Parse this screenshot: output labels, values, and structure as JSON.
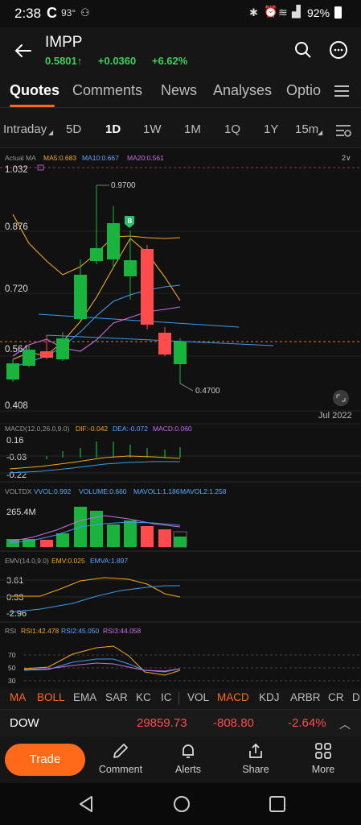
{
  "status": {
    "time": "2:38",
    "temp": "93°",
    "battery": "92%"
  },
  "header": {
    "ticker": "IMPP",
    "price": "0.5801",
    "change": "+0.0360",
    "change_pct": "+6.62%",
    "price_arrow": "↑"
  },
  "tabs": [
    "Quotes",
    "Comments",
    "News",
    "Analyses",
    "Optio"
  ],
  "periods": [
    "Intraday",
    "5D",
    "1D",
    "1W",
    "1M",
    "1Q",
    "1Y",
    "15m"
  ],
  "active_period": "1D",
  "main_chart": {
    "legend": {
      "label": "Actual MA",
      "ma5": "MA5:0.683",
      "ma10": "MA10:0.667",
      "ma20": "MA20:0.561"
    },
    "y_ticks": [
      "1.032",
      "0.876",
      "0.720",
      "0.564",
      "0.408"
    ],
    "high_label": "0.9700",
    "low_label": "0.4700",
    "date_label": "Jul 2022",
    "badge": "B",
    "layout_toggle": "2∨"
  },
  "macd": {
    "legend": {
      "label": "MACD(12.0,26.0,9.0)",
      "dif": "DIF:-0.042",
      "dea": "DEA:-0.072",
      "macd": "MACD:0.060"
    },
    "y_ticks": [
      "0.16",
      "-0.03",
      "-0.22"
    ]
  },
  "volume": {
    "legend": {
      "label": "VOLTDX",
      "vvol": "VVOL:0.992",
      "volume": "VOLUME:0.660",
      "mavol1": "MAVOL1:1.186",
      "mavol2": "MAVOL2:1.258"
    },
    "y_tick": "265.4M"
  },
  "emv": {
    "legend": {
      "label": "EMV(14.0,9.0)",
      "emv": "EMV:0.025",
      "emva": "EMVA:1.897"
    },
    "y_ticks": [
      "3.61",
      "0.33",
      "-2.96"
    ]
  },
  "rsi": {
    "legend": {
      "label": "RSI",
      "rsi1": "RSI1:42.478",
      "rsi2": "RSI2:45.050",
      "rsi3": "RSI3:44.058"
    },
    "y_ticks": [
      "70",
      "50",
      "30"
    ]
  },
  "indicators": [
    "MA",
    "BOLL",
    "EMA",
    "SAR",
    "KC",
    "IC",
    "VOL",
    "MACD",
    "KDJ",
    "ARBR",
    "CR",
    "D"
  ],
  "dow": {
    "name": "DOW",
    "value": "29859.73",
    "change": "-808.80",
    "change_pct": "-2.64%"
  },
  "bottom": {
    "trade": "Trade",
    "items": [
      "Comment",
      "Alerts",
      "Share",
      "More"
    ]
  },
  "colors": {
    "up": "#19b33d",
    "down": "#ff4b4b",
    "accent": "#ff6a1a",
    "ma5": "#f2a81d",
    "ma10": "#5aa7ff",
    "ma20": "#c86ee6"
  }
}
